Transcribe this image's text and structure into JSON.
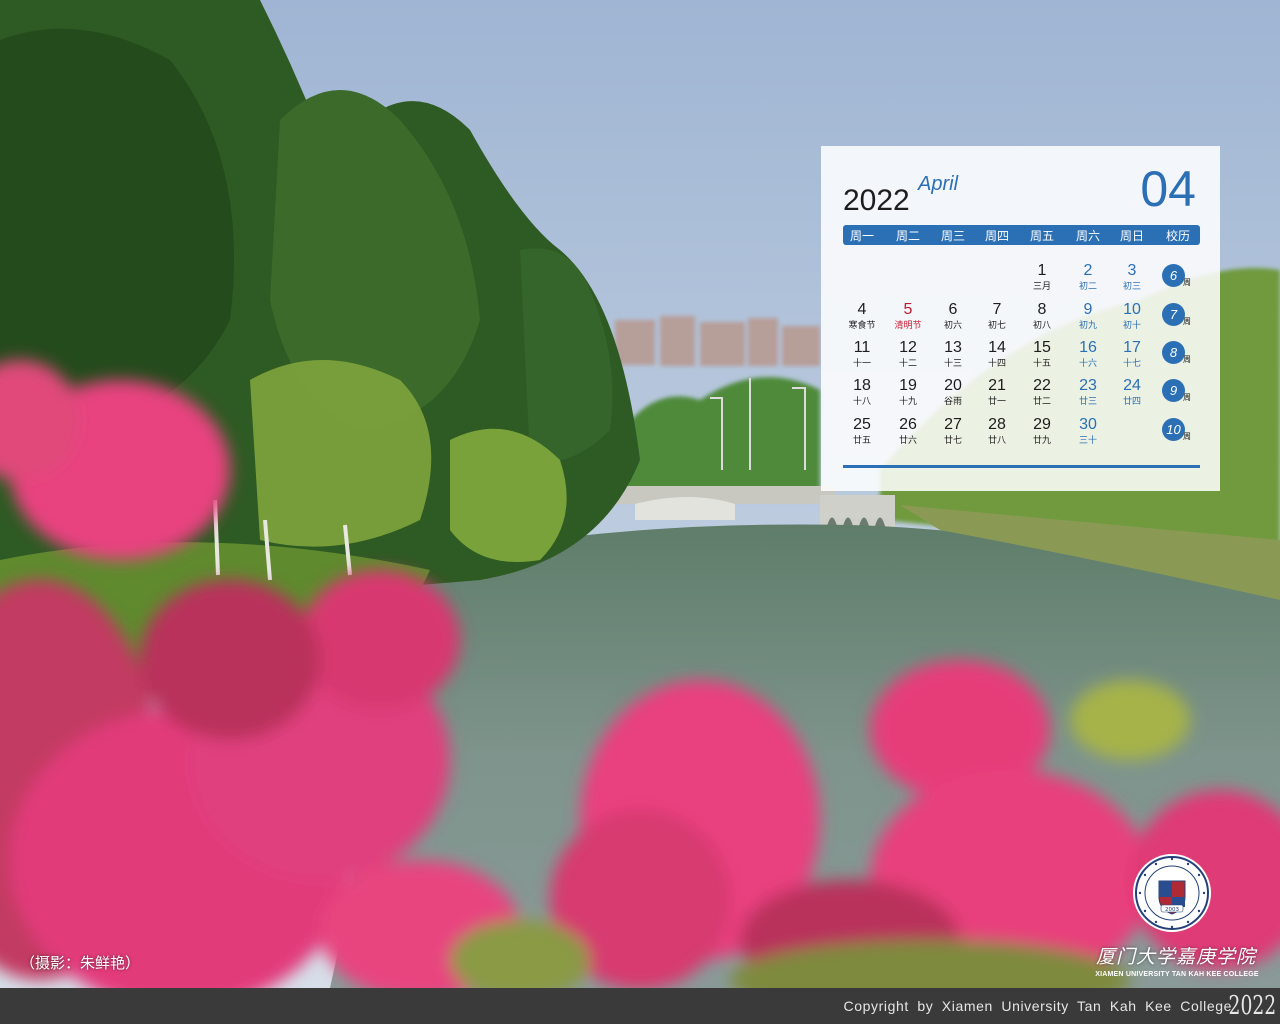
{
  "calendar": {
    "year": "2022",
    "month_en": "April",
    "month_num": "04",
    "headers": [
      "周一",
      "周二",
      "周三",
      "周四",
      "周五",
      "周六",
      "周日",
      "校历"
    ],
    "rows": [
      {
        "week": "6",
        "days": [
          null,
          null,
          null,
          null,
          {
            "n": "1",
            "l": "三月"
          },
          {
            "n": "2",
            "l": "初二",
            "t": "wk"
          },
          {
            "n": "3",
            "l": "初三",
            "t": "wk"
          }
        ]
      },
      {
        "week": "7",
        "days": [
          {
            "n": "4",
            "l": "寒食节"
          },
          {
            "n": "5",
            "l": "清明节",
            "t": "hol"
          },
          {
            "n": "6",
            "l": "初六"
          },
          {
            "n": "7",
            "l": "初七"
          },
          {
            "n": "8",
            "l": "初八"
          },
          {
            "n": "9",
            "l": "初九",
            "t": "wk"
          },
          {
            "n": "10",
            "l": "初十",
            "t": "wk"
          }
        ]
      },
      {
        "week": "8",
        "days": [
          {
            "n": "11",
            "l": "十一"
          },
          {
            "n": "12",
            "l": "十二"
          },
          {
            "n": "13",
            "l": "十三"
          },
          {
            "n": "14",
            "l": "十四"
          },
          {
            "n": "15",
            "l": "十五"
          },
          {
            "n": "16",
            "l": "十六",
            "t": "wk"
          },
          {
            "n": "17",
            "l": "十七",
            "t": "wk"
          }
        ]
      },
      {
        "week": "9",
        "days": [
          {
            "n": "18",
            "l": "十八"
          },
          {
            "n": "19",
            "l": "十九"
          },
          {
            "n": "20",
            "l": "谷雨"
          },
          {
            "n": "21",
            "l": "廿一"
          },
          {
            "n": "22",
            "l": "廿二"
          },
          {
            "n": "23",
            "l": "廿三",
            "t": "wk"
          },
          {
            "n": "24",
            "l": "廿四",
            "t": "wk"
          }
        ]
      },
      {
        "week": "10",
        "days": [
          {
            "n": "25",
            "l": "廿五"
          },
          {
            "n": "26",
            "l": "廿六"
          },
          {
            "n": "27",
            "l": "廿七"
          },
          {
            "n": "28",
            "l": "廿八"
          },
          {
            "n": "29",
            "l": "廿九"
          },
          {
            "n": "30",
            "l": "三十",
            "t": "wk"
          },
          null
        ]
      }
    ],
    "week_suffix": "周"
  },
  "photo_credit": "（摄影：朱鲜艳）",
  "college_name_cn": "厦门大学嘉庚学院",
  "college_name_en": "XIAMEN UNIVERSITY TAN KAH KEE COLLEGE",
  "seal_year": "2003",
  "footer": {
    "copyright": "Copyright by Xiamen University Tan Kah Kee College",
    "year": "2022"
  },
  "icons": {
    "college_seal": "college-seal-icon"
  },
  "colors": {
    "accent_blue": "#2b6fb5",
    "holiday_red": "#c8172f",
    "footer_bg": "#3a3a3a"
  }
}
